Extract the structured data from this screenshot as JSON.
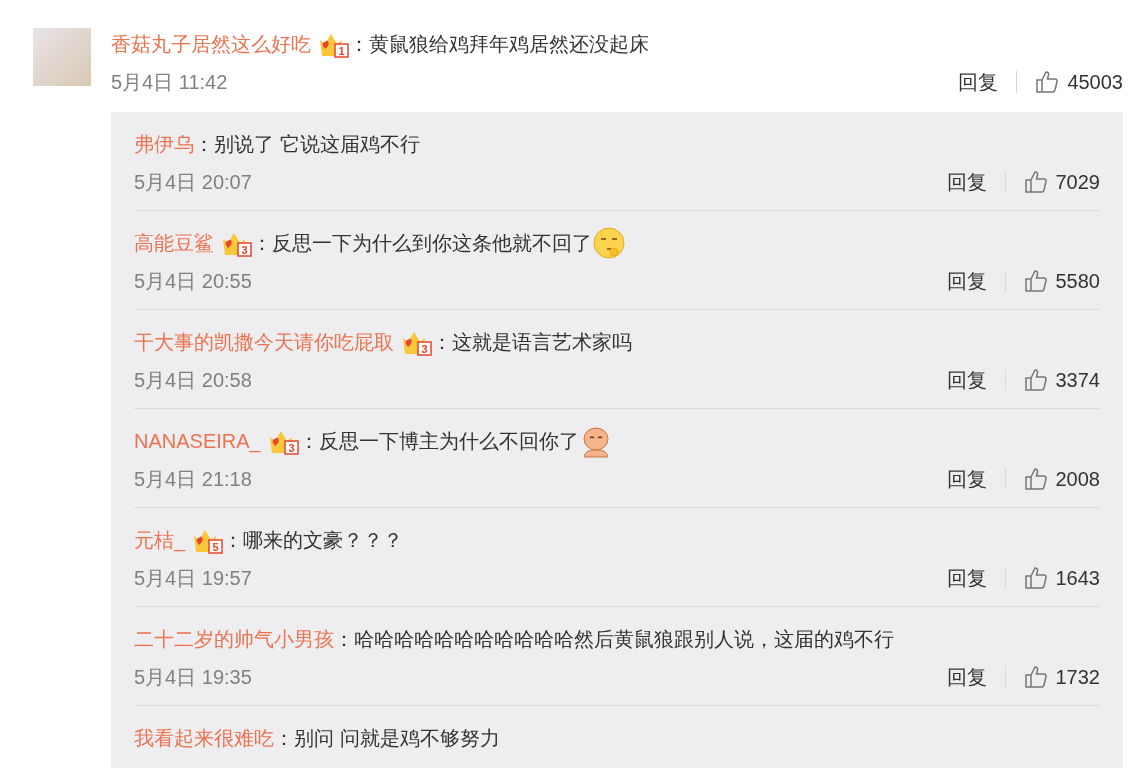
{
  "comment": {
    "author": "香菇丸子居然这么好吃",
    "badge": "1",
    "text": "：黄鼠狼给鸡拜年鸡居然还没起床",
    "time": "5月4日 11:42",
    "reply_label": "回复",
    "likes": "45003"
  },
  "replies": [
    {
      "author": "弗伊乌",
      "text": "：别说了 它说这届鸡不行",
      "time": "5月4日 20:07",
      "reply_label": "回复",
      "likes": "7029"
    },
    {
      "author": "高能豆鲨",
      "badge": "3",
      "text": "：反思一下为什么到你这条他就不回了",
      "kind": "shush",
      "time": "5月4日 20:55",
      "reply_label": "回复",
      "likes": "5580"
    },
    {
      "author": "干大事的凯撒今天请你吃屁取",
      "badge": "3",
      "text": "：这就是语言艺术家吗",
      "time": "5月4日 20:58",
      "reply_label": "回复",
      "likes": "3374"
    },
    {
      "author": "NANASEIRA_",
      "badge": "3",
      "text": "：反思一下博主为什么不回你了",
      "kind": "baby",
      "time": "5月4日 21:18",
      "reply_label": "回复",
      "likes": "2008"
    },
    {
      "author": "元桔_",
      "badge": "5",
      "text": "：哪来的文豪？？？",
      "time": "5月4日 19:57",
      "reply_label": "回复",
      "likes": "1643"
    },
    {
      "author": "二十二岁的帅气小男孩",
      "text": "：哈哈哈哈哈哈哈哈哈哈哈然后黄鼠狼跟别人说，这届的鸡不行",
      "time": "5月4日 19:35",
      "reply_label": "回复",
      "likes": "1732"
    },
    {
      "author": "我看起来很难吃",
      "text": "：别问 问就是鸡不够努力"
    }
  ]
}
